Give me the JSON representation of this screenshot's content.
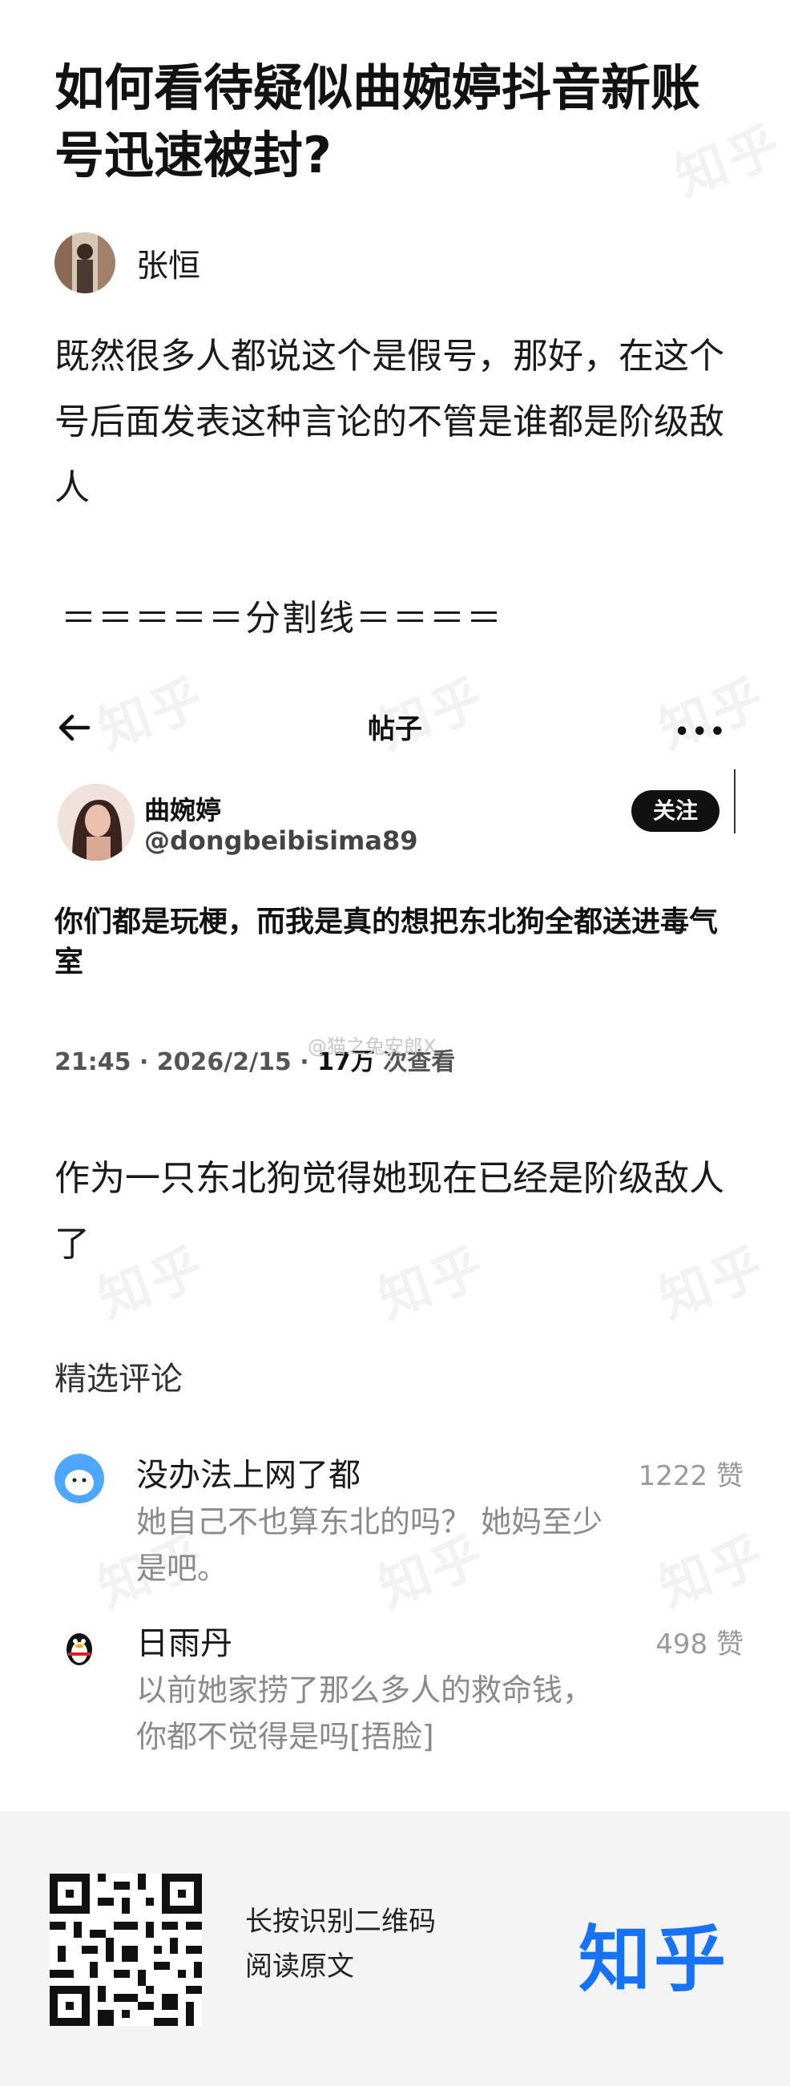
{
  "question": {
    "title": "如何看待疑似曲婉婷抖音新账号迅速被封?"
  },
  "author": {
    "name": "张恒"
  },
  "answer": {
    "paragraph1": "既然很多人都说这个是假号，那好，在这个号后面发表这种言论的不管是谁都是阶级敌人",
    "divider": "＝＝＝＝＝分割线＝＝＝＝",
    "paragraph2": "作为一只东北狗觉得她现在已经是阶级敌人了"
  },
  "embedded_post": {
    "nav_title": "帖子",
    "user_name": "曲婉婷",
    "user_handle": "@dongbeibisima89",
    "follow_label": "关注",
    "text": "你们都是玩梗，而我是真的想把东北狗全都送进毒气室",
    "meta_time": "21:45 · 2026/2/15 · ",
    "meta_views": "17万",
    "meta_suffix": " 次查看",
    "weibo_watermark": "@猫之兔安郎X"
  },
  "comments_section": {
    "title": "精选评论",
    "items": [
      {
        "name": "没办法上网了都",
        "text": "她自己不也算东北的吗？  她妈至少是吧。",
        "likes": "1222  赞"
      },
      {
        "name": "日雨丹",
        "text": "以前她家捞了那么多人的救命钱，你都不觉得是吗[捂脸]",
        "likes": "498  赞"
      }
    ]
  },
  "footer": {
    "hint_line1": "长按识别二维码",
    "hint_line2": "阅读原文",
    "logo": "知乎"
  },
  "watermark_text": "知乎",
  "colors": {
    "brand": "#1772f6",
    "comment_text": "#8a8a8a",
    "footer_bg": "#f4f4f4"
  },
  "icons": [
    "back-arrow-icon",
    "more-icon",
    "qr-code-icon",
    "zhihu-logo"
  ]
}
